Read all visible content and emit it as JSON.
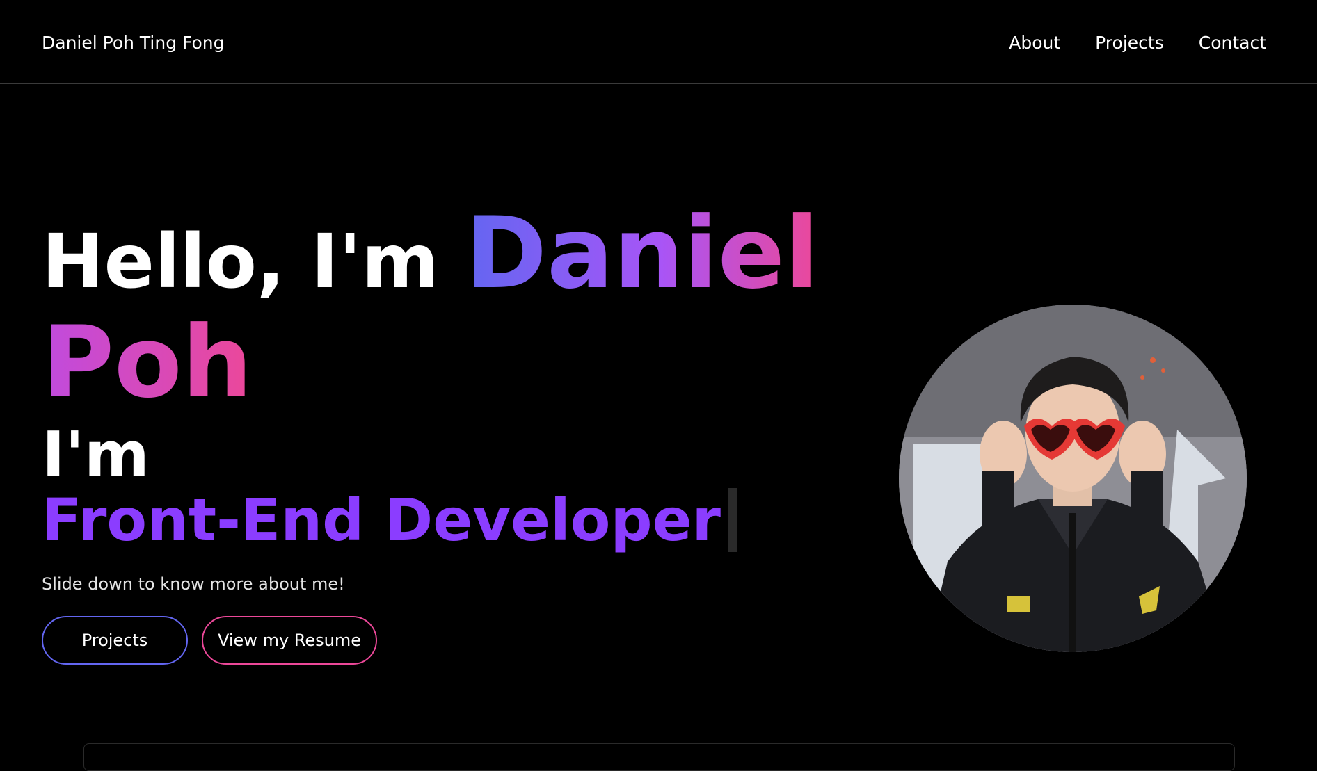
{
  "header": {
    "brand": "Daniel Poh Ting Fong",
    "nav": [
      {
        "label": "About"
      },
      {
        "label": "Projects"
      },
      {
        "label": "Contact"
      }
    ]
  },
  "hero": {
    "greeting": "Hello, I'm ",
    "first_name": "Daniel",
    "last_name": "Poh",
    "im_label": "I'm",
    "role": "Front-End Developer",
    "tagline": "Slide down to know more about me!",
    "buttons": {
      "projects": "Projects",
      "resume": "View my Resume"
    },
    "photo": "profile-photo"
  },
  "colors": {
    "background": "#000000",
    "accent_indigo": "#6366f1",
    "accent_purple": "#8b3dff",
    "accent_pink": "#ec4899"
  }
}
